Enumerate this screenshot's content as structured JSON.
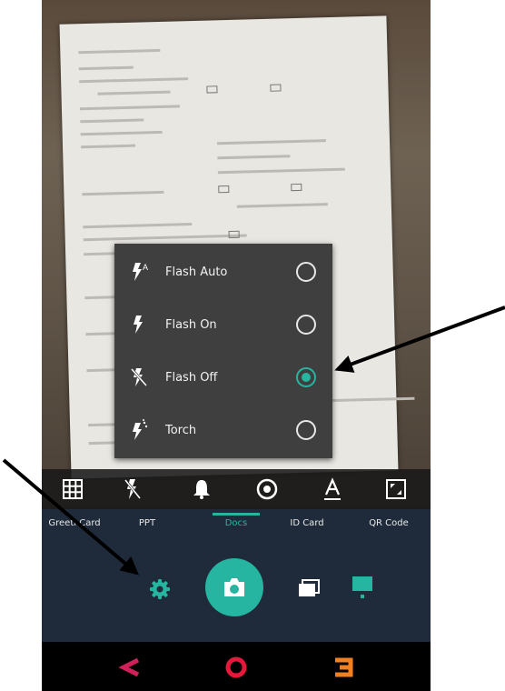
{
  "flash_menu": {
    "options": [
      {
        "label": "Flash Auto",
        "icon": "flash-auto-icon",
        "selected": false
      },
      {
        "label": "Flash On",
        "icon": "flash-on-icon",
        "selected": false
      },
      {
        "label": "Flash Off",
        "icon": "flash-off-icon",
        "selected": true
      },
      {
        "label": "Torch",
        "icon": "torch-icon",
        "selected": false
      }
    ]
  },
  "toolbar": {
    "icons": [
      "grid-icon",
      "flash-off-icon",
      "bell-icon",
      "record-icon",
      "text-icon",
      "crop-icon"
    ]
  },
  "modes": {
    "items": [
      "Greeti  Card",
      "PPT",
      "Docs",
      "ID Card",
      "QR Code"
    ],
    "active": "Docs"
  },
  "controls": {
    "icons": [
      "settings-icon",
      "camera-shutter-icon",
      "gallery-icon",
      "display-icon"
    ]
  },
  "navigation": {
    "icons": [
      "back-icon",
      "home-icon",
      "recents-icon"
    ]
  },
  "colors": {
    "accent": "#26b5a0",
    "menu_bg": "#3f3f3f",
    "panel_bg": "#1f2b3b",
    "nav_back": "#d0205a",
    "nav_home": "#e5173a",
    "nav_recent": "#f08020"
  }
}
